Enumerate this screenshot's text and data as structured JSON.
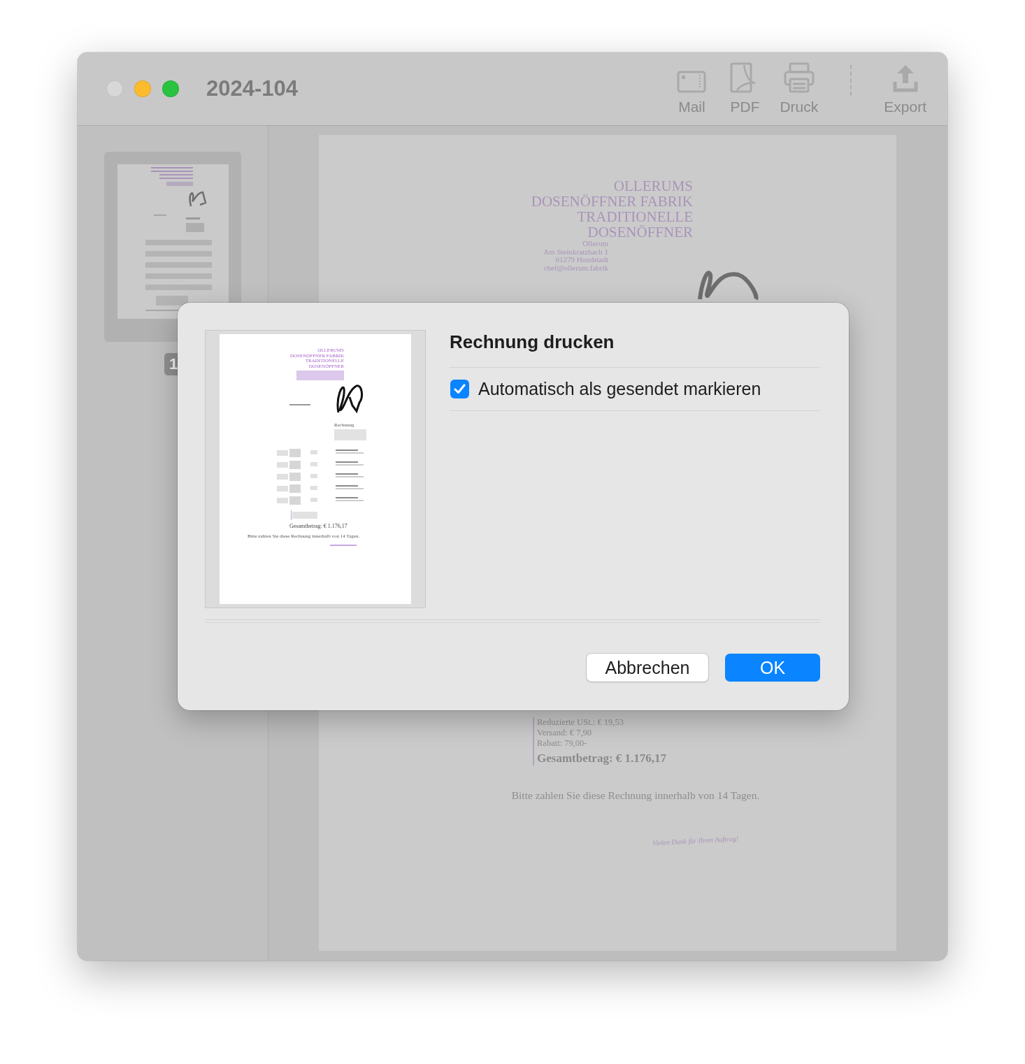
{
  "window": {
    "title": "2024-104"
  },
  "toolbar": {
    "items": [
      {
        "label": "Mail",
        "kind": "mail"
      },
      {
        "label": "PDF",
        "kind": "pdf"
      },
      {
        "label": "Druck",
        "kind": "print"
      }
    ],
    "trailing": [
      {
        "label": "Export",
        "kind": "export"
      }
    ]
  },
  "sidebar": {
    "page_number": "1"
  },
  "document": {
    "company_lines": [
      "OLLERUMS",
      "DOSENÖFFNER FABRIK",
      "TRADITIONELLE",
      "DOSENÖFFNER"
    ],
    "address_lines": [
      "Ollerum",
      "Am Steinkratzbach 1",
      "61279 Hundstadt",
      "chef@ollerum.fabrik"
    ],
    "totals_lines": [
      "Reduzierte USt.: € 19,53",
      "Versand: € 7,90",
      "Rabatt: 79,00-"
    ],
    "grand_total": "Gesamtbetrag: € 1.176,17",
    "payment_note": "Bitte zahlen Sie diese Rechnung innerhalb von 14 Tagen.",
    "closing": "Vielen Dank für Ihren Auftrag!"
  },
  "dialog": {
    "title": "Rechnung drucken",
    "preview": {
      "company_lines": [
        "OLLERUMS",
        "DOSENÖFFNER FABRIK",
        "TRADITIONELLE",
        "DOSENÖFFNER"
      ],
      "heading": "Rechnung",
      "grand_total": "Gesamtbetrag: € 1.176,17",
      "payment_note": "Bitte zahlen Sie diese Rechnung innerhalb von 14 Tagen."
    },
    "checkbox": {
      "label": "Automatisch als gesendet markieren",
      "checked": true
    },
    "buttons": [
      {
        "label": "Abbrechen",
        "kind": "secondary"
      },
      {
        "label": "OK",
        "kind": "primary"
      }
    ]
  }
}
